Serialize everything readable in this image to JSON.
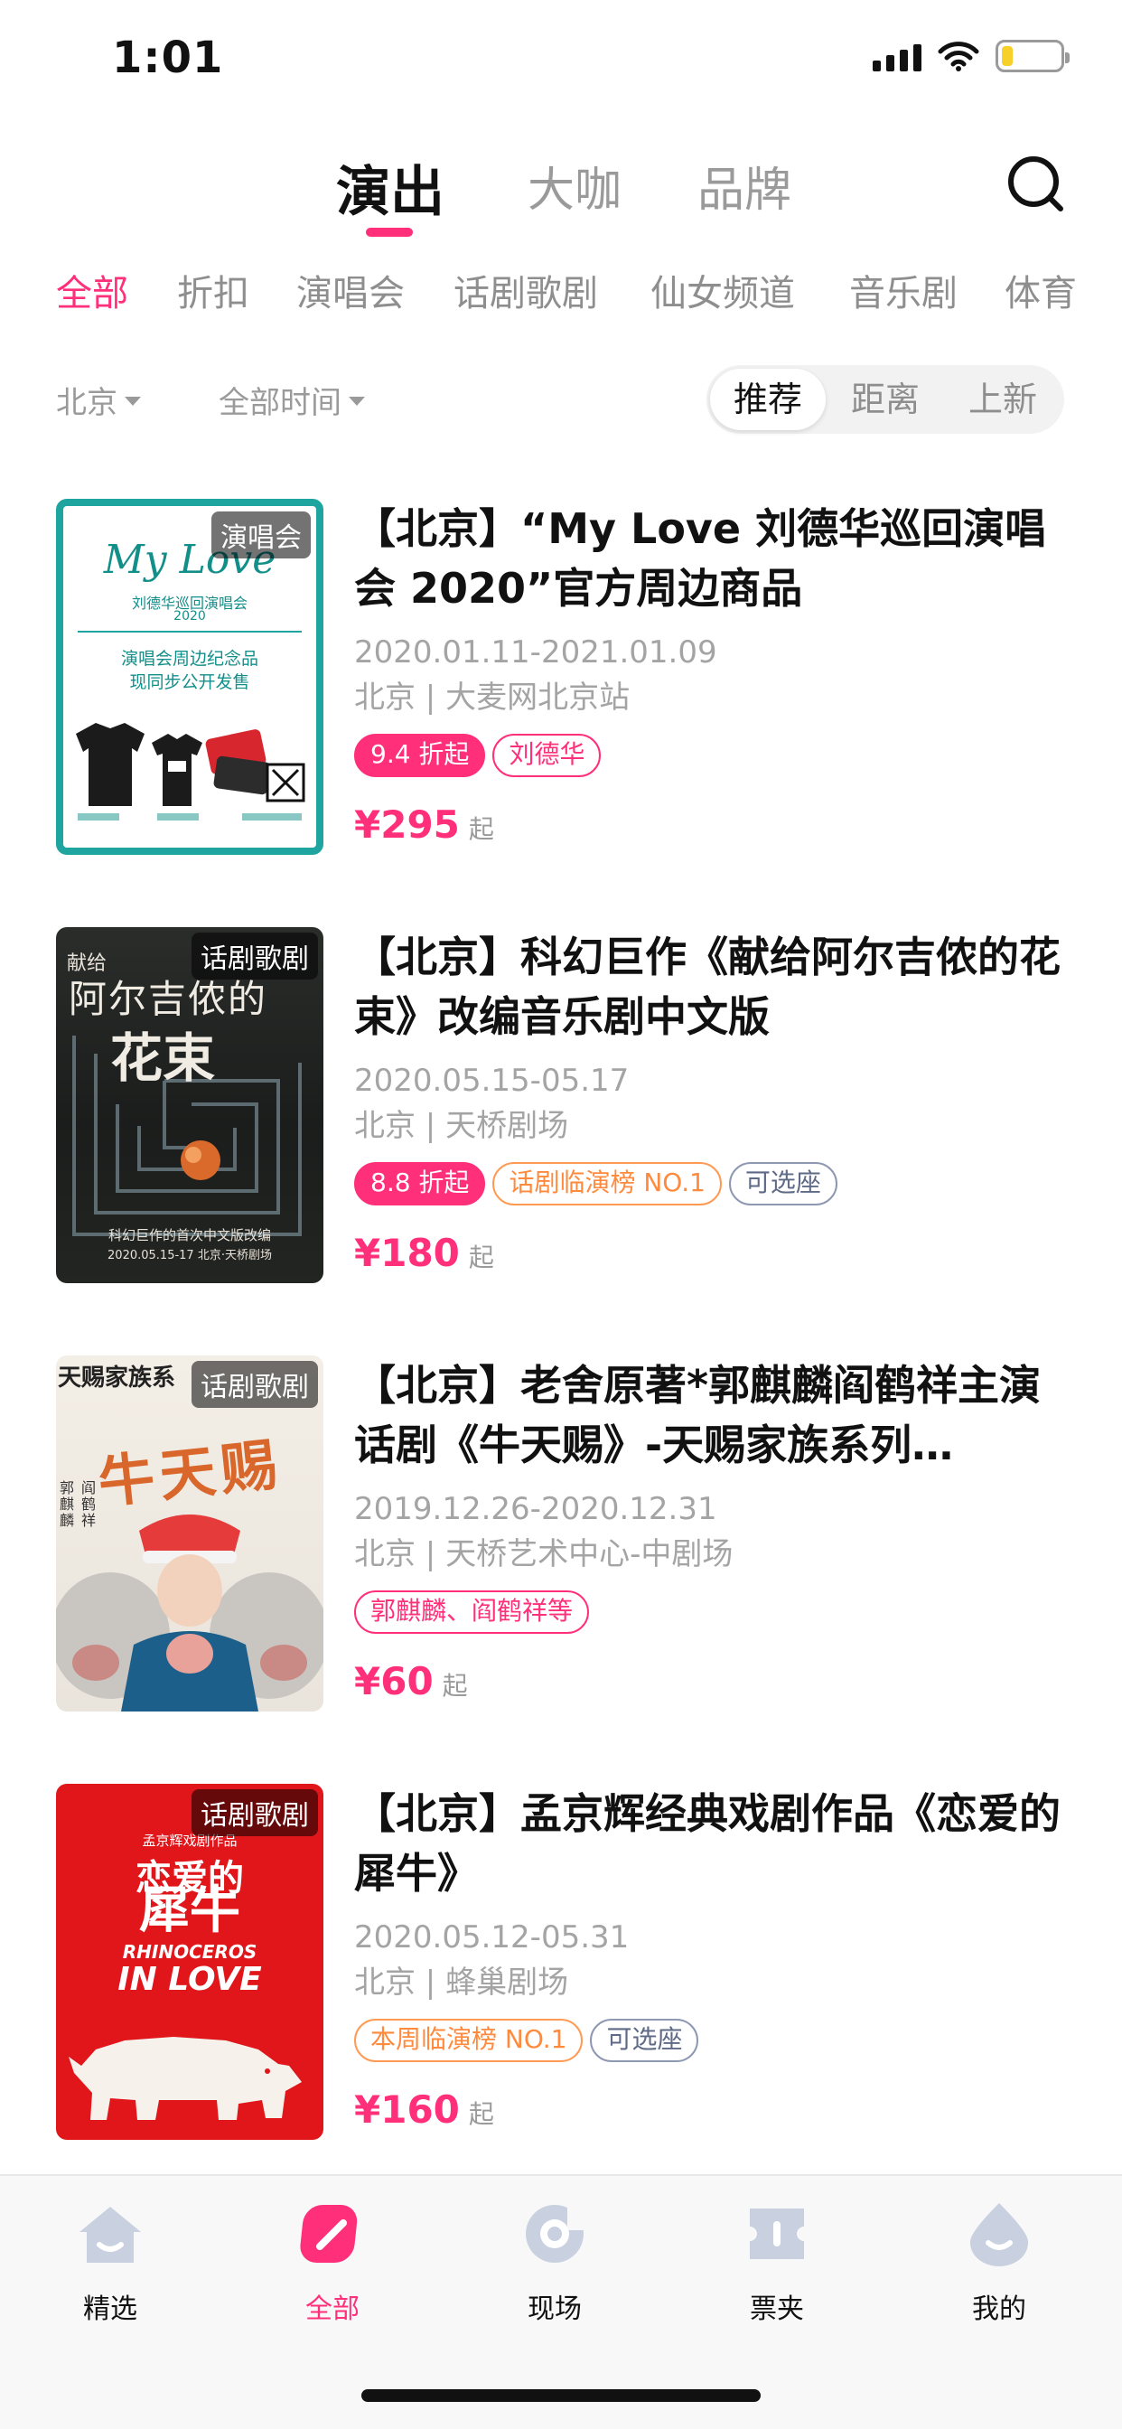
{
  "status_bar": {
    "time": "1:01",
    "battery_level": 0.2
  },
  "top_tabs": [
    {
      "label": "演出",
      "active": true
    },
    {
      "label": "大咖",
      "active": false
    },
    {
      "label": "品牌",
      "active": false
    }
  ],
  "categories": [
    {
      "label": "全部",
      "active": true
    },
    {
      "label": "折扣",
      "active": false
    },
    {
      "label": "演唱会",
      "active": false
    },
    {
      "label": "话剧歌剧",
      "active": false
    },
    {
      "label": "仙女频道",
      "active": false
    },
    {
      "label": "音乐剧",
      "active": false
    },
    {
      "label": "体育",
      "active": false
    }
  ],
  "filters": {
    "city": "北京",
    "time": "全部时间"
  },
  "sort_options": [
    {
      "label": "推荐",
      "active": true
    },
    {
      "label": "距离",
      "active": false
    },
    {
      "label": "上新",
      "active": false
    }
  ],
  "events": [
    {
      "poster_tag": "演唱会",
      "title": "【北京】“My Love 刘德华巡回演唱会 2020”官方周边商品",
      "date": "2020.01.11-2021.01.09",
      "venue": "北京 | 大麦网北京站",
      "badges": [
        {
          "text": "9.4 折起",
          "style": "discount"
        },
        {
          "text": "刘德华",
          "style": "pink"
        }
      ],
      "price": "¥295",
      "price_unit": "起",
      "poster_text": [
        "My Love",
        "刘德华巡回演唱会",
        "2020",
        "演唱会周边纪念品",
        "现同步公开发售"
      ]
    },
    {
      "poster_tag": "话剧歌剧",
      "title": "【北京】科幻巨作《献给阿尔吉侬的花束》改编音乐剧中文版",
      "date": "2020.05.15-05.17",
      "venue": "北京 | 天桥剧场",
      "badges": [
        {
          "text": "8.8 折起",
          "style": "discount"
        },
        {
          "text": "话剧临演榜 NO.1",
          "style": "orange"
        },
        {
          "text": "可选座",
          "style": "slate"
        }
      ],
      "price": "¥180",
      "price_unit": "起",
      "poster_text": [
        "献给",
        "阿尔吉侬的",
        "花束",
        "科幻巨作的首次中文版改编",
        "2020.05.15-17 北京·天桥剧场"
      ]
    },
    {
      "poster_tag": "话剧歌剧",
      "title": "【北京】老舍原著*郭麒麟阎鹤祥主演话剧《牛天赐》-天赐家族系列…",
      "date": "2019.12.26-2020.12.31",
      "venue": "北京 | 天桥艺术中心-中剧场",
      "badges": [
        {
          "text": "郭麒麟、阎鹤祥等",
          "style": "pink"
        }
      ],
      "price": "¥60",
      "price_unit": "起",
      "poster_text": [
        "天赐家族系",
        "牛天赐",
        "郭麒麟",
        "阎鹤祥"
      ]
    },
    {
      "poster_tag": "话剧歌剧",
      "title": "【北京】孟京辉经典戏剧作品《恋爱的犀牛》",
      "date": "2020.05.12-05.31",
      "venue": "北京 | 蜂巢剧场",
      "badges": [
        {
          "text": "本周临演榜 NO.1",
          "style": "orange"
        },
        {
          "text": "可选座",
          "style": "slate"
        }
      ],
      "price": "¥160",
      "price_unit": "起",
      "poster_text": [
        "孟京辉戏剧作品",
        "恋爱的",
        "犀牛",
        "RHINOCEROS",
        "IN LOVE"
      ]
    }
  ],
  "bottom_nav": [
    {
      "label": "精选",
      "icon": "home-icon",
      "active": false
    },
    {
      "label": "全部",
      "icon": "all-icon",
      "active": true
    },
    {
      "label": "现场",
      "icon": "live-icon",
      "active": false
    },
    {
      "label": "票夹",
      "icon": "ticket-icon",
      "active": false
    },
    {
      "label": "我的",
      "icon": "profile-icon",
      "active": false
    }
  ]
}
